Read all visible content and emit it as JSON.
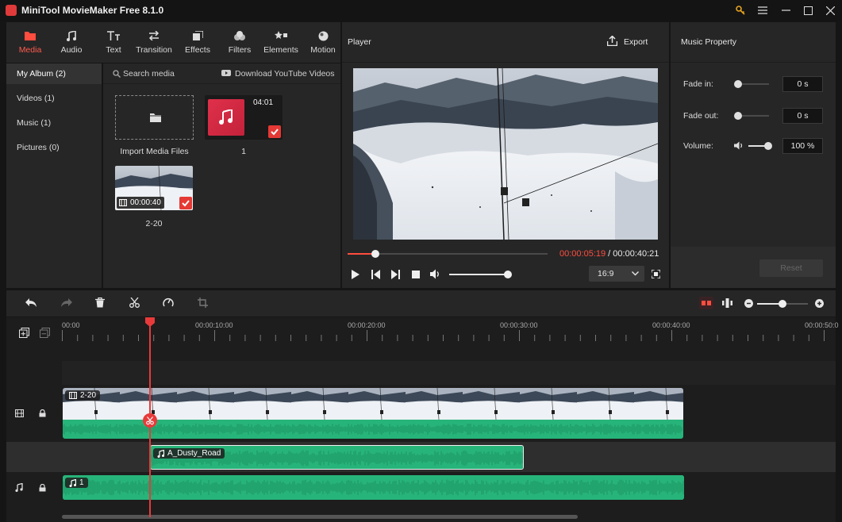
{
  "app": {
    "title": "MiniTool MovieMaker Free 8.1.0"
  },
  "colors": {
    "accent": "#ff4d3f",
    "panel": "#262626",
    "audio_green": "#27b47a",
    "window_bg": "#151515"
  },
  "toolbar": {
    "items": [
      {
        "label": "Media",
        "icon": "folder-icon",
        "active": true
      },
      {
        "label": "Audio",
        "icon": "music-note-icon"
      },
      {
        "label": "Text",
        "icon": "text-icon"
      },
      {
        "label": "Transition",
        "icon": "transition-icon"
      },
      {
        "label": "Effects",
        "icon": "effects-icon"
      },
      {
        "label": "Filters",
        "icon": "filters-icon"
      },
      {
        "label": "Elements",
        "icon": "elements-icon"
      },
      {
        "label": "Motion",
        "icon": "motion-icon"
      }
    ]
  },
  "sidebar": {
    "items": [
      {
        "label": "My Album (2)",
        "active": true
      },
      {
        "label": "Videos (1)"
      },
      {
        "label": "Music (1)"
      },
      {
        "label": "Pictures (0)"
      }
    ]
  },
  "media": {
    "search_label": "Search media",
    "download_label": "Download YouTube Videos",
    "import_label": "Import Media Files",
    "items": [
      {
        "name": "1",
        "duration": "04:01",
        "type": "music"
      },
      {
        "name": "2-20",
        "duration": "00:00:40",
        "type": "video"
      }
    ]
  },
  "player": {
    "title": "Player",
    "export_label": "Export",
    "current_time": "00:00:05:19",
    "separator": " / ",
    "total_time": "00:00:40:21",
    "progress": 0.14,
    "volume": 1.0,
    "aspect_ratio": "16:9"
  },
  "music_property": {
    "title": "Music Property",
    "fade_in_label": "Fade in:",
    "fade_in_value": "0 s",
    "fade_out_label": "Fade out:",
    "fade_out_value": "0 s",
    "volume_label": "Volume:",
    "volume_value": "100 %",
    "reset_label": "Reset"
  },
  "timeline": {
    "ruler_labels": [
      "00:00",
      "00:00:10:00",
      "00:00:20:00",
      "00:00:30:00",
      "00:00:40:00",
      "00:00:50:0"
    ],
    "zoom": 0.5,
    "video_clip": {
      "name": "2-20"
    },
    "audio_clip": {
      "name": "A_Dusty_Road"
    },
    "music_clip": {
      "name": "1"
    }
  }
}
